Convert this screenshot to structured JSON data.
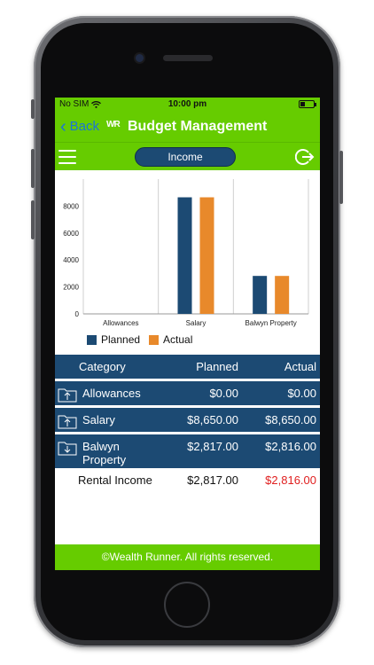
{
  "status_bar": {
    "carrier": "No SIM",
    "time": "10:00 pm"
  },
  "nav": {
    "back_label": "Back",
    "logo": "WR",
    "title": "Budget Management"
  },
  "subnav": {
    "segment_label": "Income"
  },
  "colors": {
    "brand_green": "#66cc00",
    "navy": "#1c4a73",
    "planned": "#1c4a73",
    "actual": "#e8892b",
    "negative": "#e02020"
  },
  "chart_data": {
    "type": "bar",
    "categories": [
      "Allowances",
      "Salary",
      "Balwyn Property"
    ],
    "series": [
      {
        "name": "Planned",
        "values": [
          0,
          8650,
          2817
        ]
      },
      {
        "name": "Actual",
        "values": [
          0,
          8650,
          2816
        ]
      }
    ],
    "y_ticks": [
      "0",
      "2000",
      "4000",
      "6000",
      "8000"
    ],
    "ylim": [
      0,
      10000
    ],
    "grid": "vertical",
    "legend": "bottom-left"
  },
  "legend": {
    "planned": "Planned",
    "actual": "Actual"
  },
  "table": {
    "headers": {
      "category": "Category",
      "planned": "Planned",
      "actual": "Actual"
    },
    "rows": [
      {
        "category": "Allowances",
        "planned": "$0.00",
        "actual": "$0.00"
      },
      {
        "category": "Salary",
        "planned": "$8,650.00",
        "actual": "$8,650.00"
      },
      {
        "category_line1": "Balwyn",
        "category_line2": "Property",
        "planned": "$2,817.00",
        "actual": "$2,816.00"
      },
      {
        "category": "Rental Income",
        "planned": "$2,817.00",
        "actual": "$2,816.00"
      }
    ]
  },
  "footer": {
    "text": "©Wealth Runner. All rights reserved."
  }
}
